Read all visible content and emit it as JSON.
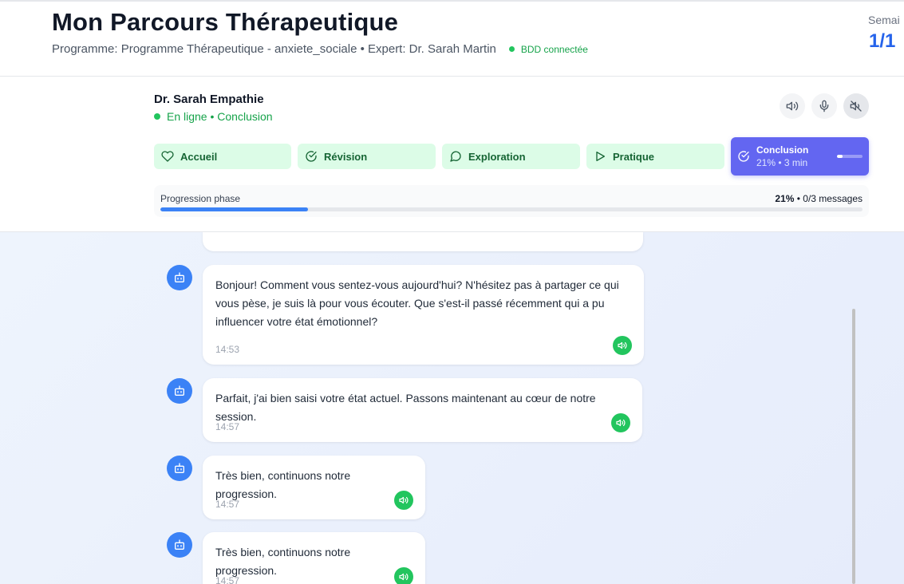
{
  "header": {
    "title": "Mon Parcours Thérapeutique",
    "subtitle": "Programme: Programme Thérapeutique - anxiete_sociale • Expert: Dr. Sarah Martin",
    "db_status": "BDD connectée",
    "week_label": "Semai",
    "week_value": "1/1"
  },
  "session": {
    "expert_name": "Dr. Sarah Empathie",
    "expert_status": "En ligne • Conclusion",
    "controls": [
      {
        "name": "speaker-icon"
      },
      {
        "name": "microphone-icon"
      },
      {
        "name": "mute-icon",
        "active": true
      }
    ],
    "phases": [
      {
        "label": "Accueil",
        "icon": "heart-icon",
        "state": "done"
      },
      {
        "label": "Révision",
        "icon": "check-circle-icon",
        "state": "done"
      },
      {
        "label": "Exploration",
        "icon": "chat-bubble-icon",
        "state": "done"
      },
      {
        "label": "Pratique",
        "icon": "play-icon",
        "state": "done"
      },
      {
        "label": "Conclusion",
        "icon": "check-circle-icon",
        "state": "current",
        "meta": "21% • 3 min",
        "progress": 0.21
      }
    ],
    "progress": {
      "label": "Progression phase",
      "percent_text": "21%",
      "messages_text": " • 0/3 messages",
      "value": 0.21
    }
  },
  "messages": [
    {
      "text": "Bonjour! Comment vous sentez-vous aujourd'hui? N'hésitez pas à partager ce qui vous pèse, je suis là pour vous écouter. Que s'est-il passé récemment qui a pu influencer votre état émotionnel?",
      "time": "14:53"
    },
    {
      "text": "Parfait, j'ai bien saisi votre état actuel. Passons maintenant au cœur de notre session.",
      "time": "14:57"
    },
    {
      "text": "Très bien, continuons notre progression.",
      "time": "14:57"
    },
    {
      "text": "Très bien, continuons notre progression.",
      "time": "14:57"
    }
  ],
  "colors": {
    "accent": "#2563eb",
    "phase_done_bg": "#dcfce7",
    "phase_current_bg": "#6366f1",
    "online_green": "#22c55e"
  }
}
